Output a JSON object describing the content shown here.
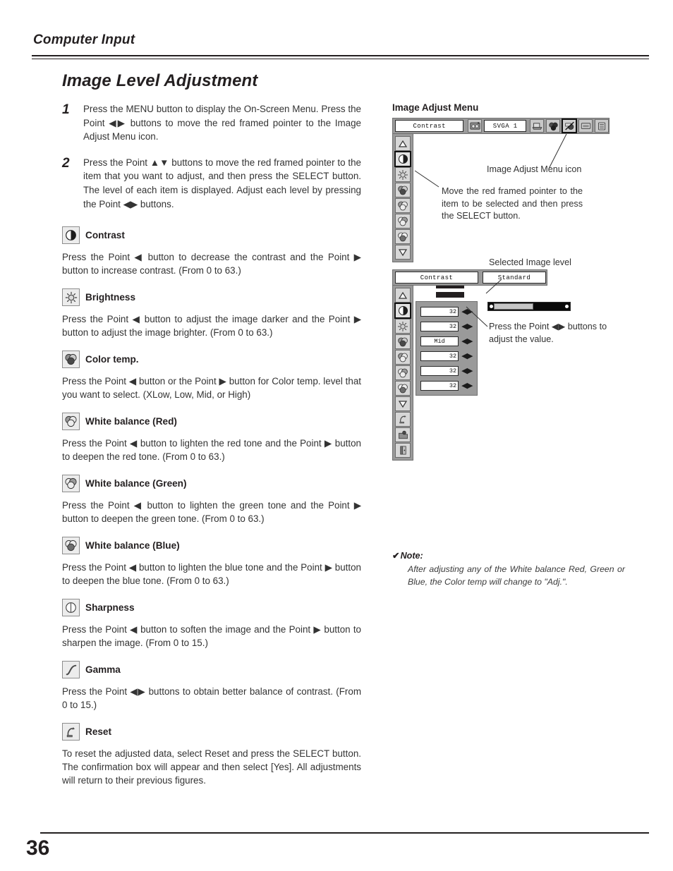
{
  "header": {
    "section_title": "Computer Input",
    "page_title": "Image Level Adjustment"
  },
  "steps": [
    {
      "num": "1",
      "text": "Press the MENU button to display the On-Screen Menu.  Press the Point ◀▶ buttons to move the red framed pointer to the Image Adjust Menu icon."
    },
    {
      "num": "2",
      "text": "Press the Point ▲▼ buttons to move the red framed pointer to the item that you want to adjust, and then press the SELECT button.  The level of each item is displayed.  Adjust each level by pressing the Point ◀▶ buttons."
    }
  ],
  "sections": [
    {
      "icon": "contrast-icon",
      "title": "Contrast",
      "body": "Press the Point ◀ button to decrease the contrast and the Point ▶ button to increase contrast.  (From 0 to 63.)"
    },
    {
      "icon": "brightness-icon",
      "title": "Brightness",
      "body": "Press the Point ◀ button to adjust the image darker and the Point ▶ button to adjust the image brighter.  (From 0 to 63.)"
    },
    {
      "icon": "color-temp-icon",
      "title": "Color temp.",
      "body": "Press the Point ◀ button or the Point ▶ button for Color temp. level that you want to select. (XLow, Low, Mid, or High)"
    },
    {
      "icon": "white-balance-red-icon",
      "title": "White balance (Red)",
      "body": "Press the Point ◀ button to lighten the red tone and the Point ▶ button to deepen the red tone.  (From 0 to 63.)"
    },
    {
      "icon": "white-balance-green-icon",
      "title": "White balance (Green)",
      "body": "Press the Point ◀ button to lighten the green tone and the Point ▶ button to deepen the green tone.  (From 0 to 63.)"
    },
    {
      "icon": "white-balance-blue-icon",
      "title": "White balance (Blue)",
      "body": "Press the Point ◀ button to lighten the blue tone and the Point ▶ button to deepen the blue tone.  (From 0 to 63.)"
    },
    {
      "icon": "sharpness-icon",
      "title": "Sharpness",
      "body": "Press the Point ◀ button to soften the image and the Point ▶ button to sharpen the image.  (From 0 to 15.)"
    },
    {
      "icon": "gamma-icon",
      "title": "Gamma",
      "body": "Press the Point ◀▶ buttons to obtain better balance of contrast.  (From 0 to 15.)"
    },
    {
      "icon": "reset-icon",
      "title": "Reset",
      "body": "To reset the adjusted data, select Reset and press the SELECT button.  The confirmation box will appear and then select [Yes].  All adjustments will return to their previous figures."
    }
  ],
  "right": {
    "menu_heading": "Image Adjust Menu",
    "osd_top": {
      "selected_item_label": "Contrast",
      "input_label": "SVGA 1",
      "top_icons": [
        "system-icon",
        "computer-icon",
        "color-adjust-icon",
        "image-adjust-icon",
        "screen-icon",
        "setting-icon"
      ],
      "selected_top_icon": "image-adjust-icon",
      "rail_icons": [
        "scroll-up-icon",
        "contrast-icon",
        "brightness-icon",
        "color-temp-icon",
        "white-balance-red-icon",
        "white-balance-green-icon",
        "white-balance-blue-icon",
        "scroll-down-icon"
      ],
      "selected_rail_icon": "contrast-icon"
    },
    "callouts": {
      "menu_icon": "Image Adjust Menu icon",
      "move_pointer": "Move the red framed pointer to the item to be selected and then press the SELECT button.",
      "selected_image_level": "Selected Image level",
      "adjust_value": "Press the Point ◀▶ buttons to adjust the value."
    },
    "osd_bottom": {
      "selected_item_label": "Contrast",
      "image_level_label": "Standard",
      "rail_icons": [
        "scroll-up-icon",
        "contrast-icon",
        "brightness-icon",
        "color-temp-icon",
        "white-balance-red-icon",
        "white-balance-green-icon",
        "white-balance-blue-icon",
        "scroll-down-icon",
        "reset-icon",
        "store-icon",
        "quit-icon"
      ],
      "selected_rail_icon": "contrast-icon",
      "values": [
        {
          "name": "contrast",
          "value": "32",
          "type": "number"
        },
        {
          "name": "brightness",
          "value": "32",
          "type": "number"
        },
        {
          "name": "color-temp",
          "value": "Mid",
          "type": "text"
        },
        {
          "name": "white-balance-red",
          "value": "32",
          "type": "number"
        },
        {
          "name": "white-balance-green",
          "value": "32",
          "type": "number"
        },
        {
          "name": "white-balance-blue",
          "value": "32",
          "type": "number"
        }
      ],
      "gauge_percent": 50
    },
    "note": {
      "label": "Note:",
      "text": "After adjusting any of the White balance Red, Green or Blue, the Color temp will change to \"Adj.\"."
    }
  },
  "footer": {
    "page_number": "36"
  }
}
